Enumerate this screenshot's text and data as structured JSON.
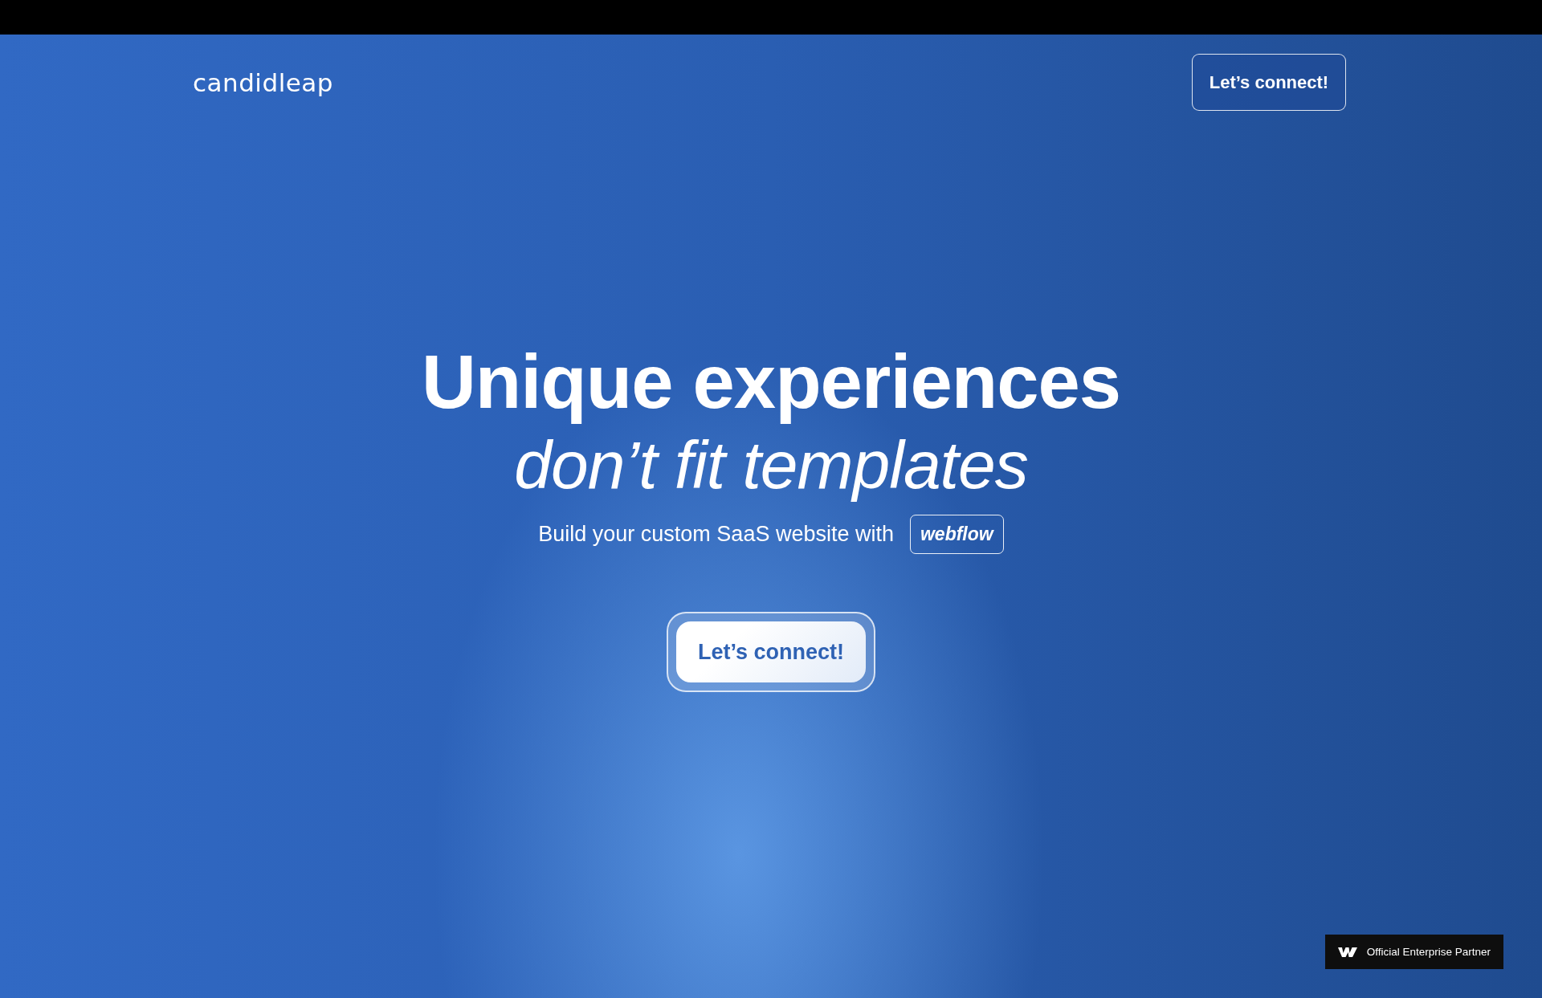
{
  "header": {
    "logo": "candidleap",
    "button": "Let’s connect!"
  },
  "hero": {
    "title": "Unique experiences",
    "subtitle": "don’t fit templates",
    "tagline": "Build your custom SaaS website with",
    "badge": "webflow",
    "cta": "Let’s connect!"
  },
  "partner_badge": {
    "label": "Official Enterprise Partner"
  }
}
